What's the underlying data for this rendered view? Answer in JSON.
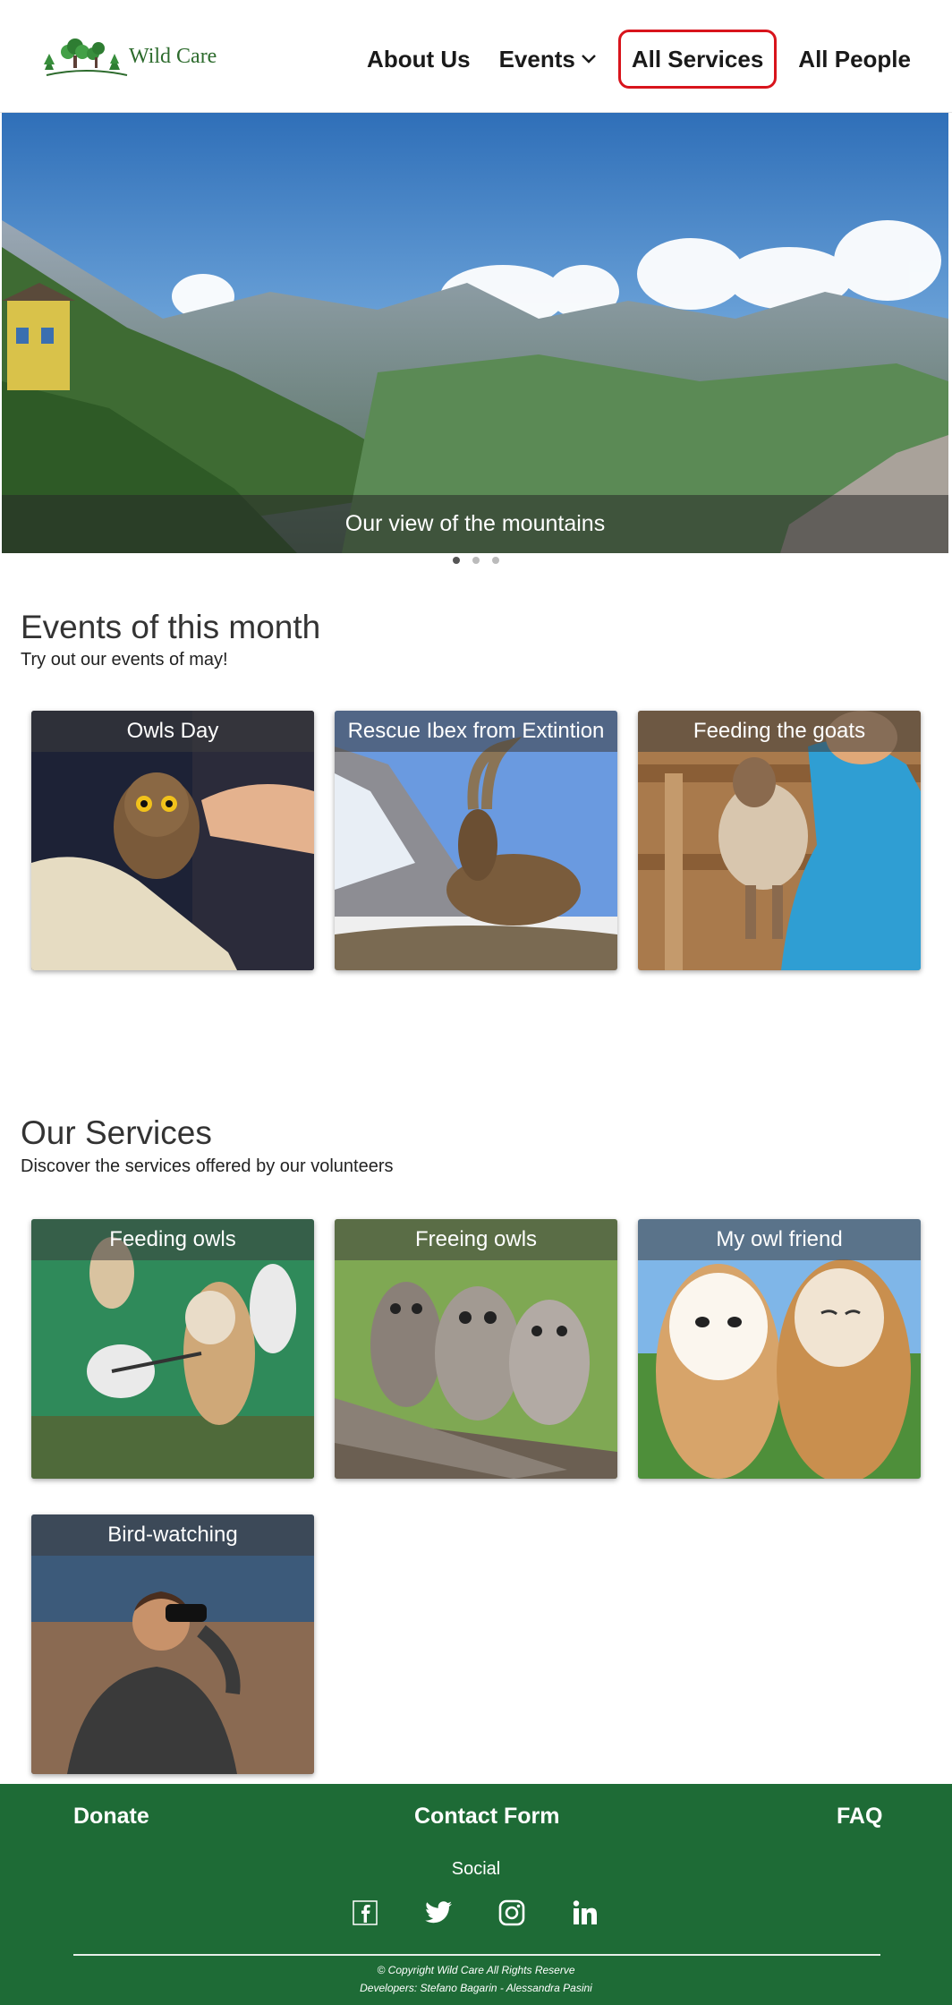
{
  "header": {
    "logo_text": "Wild Care",
    "nav": {
      "about": "About Us",
      "events": "Events",
      "services": "All Services",
      "people": "All People"
    }
  },
  "hero": {
    "caption": "Our view of the mountains",
    "slides": 3,
    "active_slide": 1
  },
  "events": {
    "title": "Events of this month",
    "subtitle": "Try out our events of may!",
    "cards": [
      {
        "title": "Owls Day"
      },
      {
        "title": "Rescue Ibex from Extintion"
      },
      {
        "title": "Feeding the goats"
      }
    ]
  },
  "services": {
    "title": "Our Services",
    "subtitle": "Discover the services offered by our volunteers",
    "cards": [
      {
        "title": "Feeding owls"
      },
      {
        "title": "Freeing owls"
      },
      {
        "title": "My owl friend"
      },
      {
        "title": "Bird-watching"
      }
    ]
  },
  "footer": {
    "donate": "Donate",
    "contact": "Contact Form",
    "faq": "FAQ",
    "social_label": "Social",
    "icons": [
      "facebook-icon",
      "twitter-icon",
      "instagram-icon",
      "linkedin-icon"
    ],
    "copyright": "© Copyright Wild Care All Rights Reserve",
    "developers": "Developers: Stefano Bagarin - Alessandra Pasini"
  },
  "colors": {
    "footer_bg": "#1e6b36",
    "active_nav_border": "#d8141c",
    "logo_green": "#2d6b2d"
  }
}
